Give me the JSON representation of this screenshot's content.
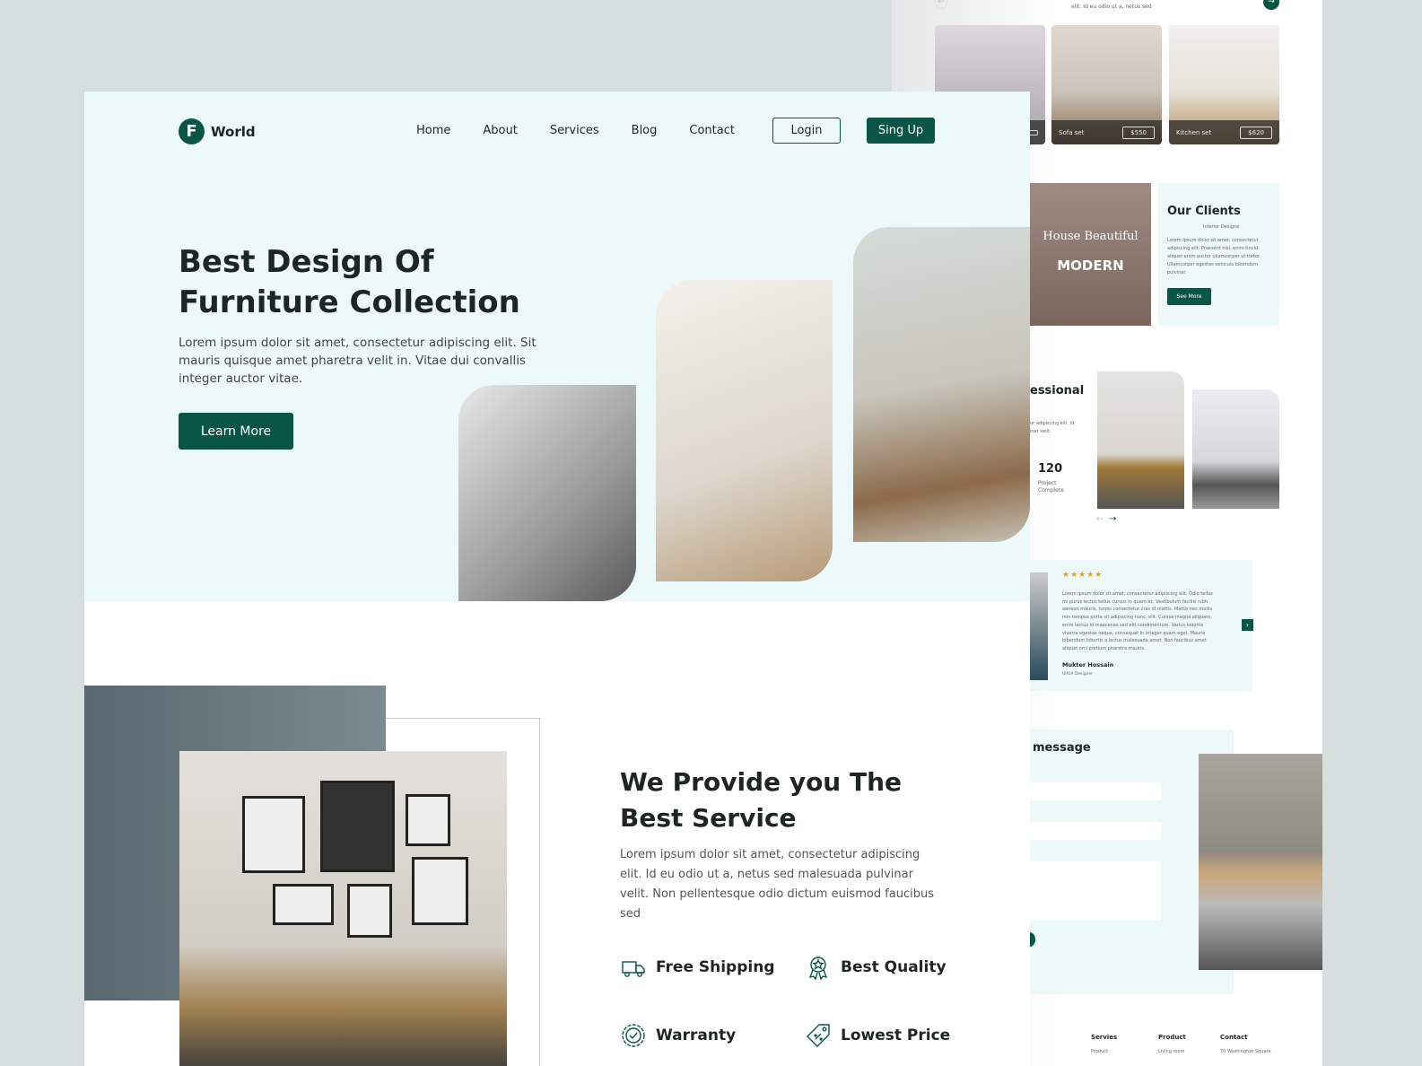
{
  "back": {
    "intro_text": "elit. Id eu odio ut a, netus sed",
    "products": [
      {
        "name": "",
        "price": ""
      },
      {
        "name": "Sofa set",
        "price": "$550"
      },
      {
        "name": "Kitchen set",
        "price": "$620"
      }
    ],
    "brands": [
      "House Beautiful",
      "MODERN"
    ],
    "clients": {
      "title": "Our Clients",
      "subtitle": "Interior Designe",
      "text": "Lorem ipsum dolor sit amet, consectetur adipiscing elit. Praesent nisl, enim tincid aliquet enim auctor ullamcorper ut tortor. Ullamcorper egestas vehicula bibendum pulvinar.",
      "button": "See More"
    },
    "professional": {
      "title": "essional",
      "text": "ur adipiscing elit. Id inar velit.",
      "stat_value": "120",
      "stat_label": "Project Complete"
    },
    "testimonial": {
      "rating": 5,
      "stars": "★★★★★",
      "text": "Lorem ipsum dolor sit amet, consectetur adipiscing elit. Odio tellus mi purus lectus tellus cursus in quam ac. Vestibulum facilisi nibh aenean mauris, turpis consectetur cras id mattis. Mattis nec mollis non tempus porta sit adipiscing nunc, elit. Cursus magna aliquam enim lectus id maecenas sed elit condimentum. Varius lobortis viverra egestas neque, consequat in integer quam eget. Mauris bibendum lobortis a lectus malesuada amet. Non faucibus amet aliquet orci pretium pharetra mauris.",
      "name": "Mukter Hossain",
      "role": "UI/UX Designer"
    },
    "message": {
      "title": "message"
    },
    "footer": [
      {
        "title": "Servies",
        "item": "Product"
      },
      {
        "title": "Product",
        "item": "Living room"
      },
      {
        "title": "Contact",
        "item": "70 Washington Square"
      }
    ]
  },
  "logo": {
    "mark": "F",
    "text": "World"
  },
  "nav": [
    "Home",
    "About",
    "Services",
    "Blog",
    "Contact"
  ],
  "login": "Login",
  "signup": "Sing Up",
  "hero": {
    "title": "Best Design Of Furniture Collection",
    "text": "Lorem ipsum dolor sit amet, consectetur adipiscing elit. Sit mauris quisque amet pharetra velit in. Vitae dui convallis integer auctor vitae.",
    "button": "Learn More"
  },
  "service": {
    "title": "We Provide you The Best Service",
    "text": "Lorem ipsum dolor sit amet, consectetur adipiscing elit. Id eu odio ut a, netus sed malesuada pulvinar velit. Non pellentesque odio dictum euismod faucibus sed",
    "features": [
      {
        "label": "Free Shipping",
        "icon": "truck"
      },
      {
        "label": "Best Quality",
        "icon": "award-badge"
      },
      {
        "label": "Warranty",
        "icon": "check-badge"
      },
      {
        "label": "Lowest Price",
        "icon": "price-tag"
      }
    ]
  },
  "colors": {
    "primary": "#0a5548",
    "mint": "#edf9f8",
    "background": "#d7dfde",
    "star": "#f0a000"
  }
}
